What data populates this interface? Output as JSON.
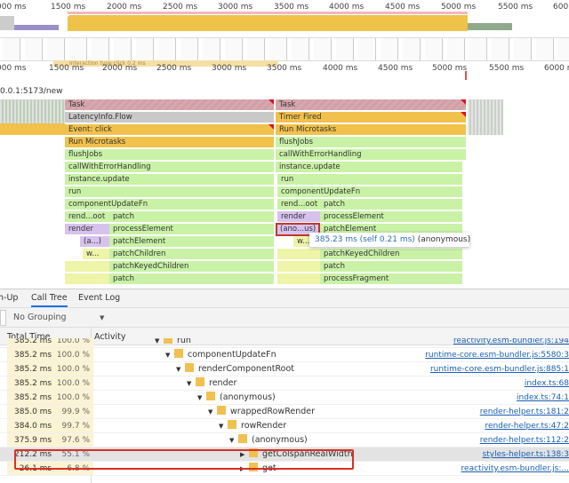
{
  "overview": {
    "ticks": [
      "000 ms",
      "1500 ms",
      "2000 ms",
      "2500 ms",
      "3000 ms",
      "3500 ms",
      "4000 ms",
      "4500 ms",
      "5000 ms",
      "5500 ms",
      "600"
    ]
  },
  "ruler": {
    "ticks": [
      "000 ms",
      "1500 ms",
      "2000 ms",
      "2500 ms",
      "3000 ms",
      "3500 ms",
      "4000 ms",
      "4500 ms",
      "5000 ms",
      "5500 ms",
      "6000 m"
    ],
    "interaction_label": "Interaction type:click 0.2 ms"
  },
  "main": {
    "url": "0.0.1:5173/new"
  },
  "flame_left": [
    "Task",
    "LatencyInfo.Flow",
    "Event: click",
    "Run Microtasks",
    "flushJobs",
    "callWithErrorHandling",
    "instance.update",
    "run",
    "componentUpdateFn",
    "rend...oot",
    "patch",
    "render",
    "processElement",
    "(a...)",
    "patchElement",
    "w...",
    "patchChildren",
    "patchKeyedChildren",
    "patch"
  ],
  "flame_right": [
    "Task",
    "Timer Fired",
    "Run Microtasks",
    "flushJobs",
    "callWithErrorHandling",
    "instance.update",
    "run",
    "componentUpdateFn",
    "rend...oot",
    "patch",
    "render",
    "processElement",
    "(ano...us)",
    "patchElement",
    "w...",
    "patchKeyedChildren",
    "patch",
    "processFragment"
  ],
  "tooltip": {
    "time": "385.23 ms (self 0.21 ms)",
    "name": "(anonymous)"
  },
  "tabs": [
    "n-Up",
    "Call Tree",
    "Event Log"
  ],
  "grouping": "No Grouping",
  "columns": {
    "total": "Total Time",
    "activity": "Activity"
  },
  "rows": [
    {
      "time": "385.2 ms",
      "pct": "100.0 %",
      "name": "run",
      "link": "reactivity.esm-bundler.js:194"
    },
    {
      "time": "385.2 ms",
      "pct": "100.0 %",
      "name": "componentUpdateFn",
      "link": "runtime-core.esm-bundler.js:5580:3"
    },
    {
      "time": "385.2 ms",
      "pct": "100.0 %",
      "name": "renderComponentRoot",
      "link": "runtime-core.esm-bundler.js:885:1"
    },
    {
      "time": "385.2 ms",
      "pct": "100.0 %",
      "name": "render",
      "link": "index.ts:68"
    },
    {
      "time": "385.2 ms",
      "pct": "100.0 %",
      "name": "(anonymous)",
      "link": "index.ts:74:1"
    },
    {
      "time": "385.0 ms",
      "pct": "99.9 %",
      "name": "wrappedRowRender",
      "link": "render-helper.ts:181:2"
    },
    {
      "time": "384.0 ms",
      "pct": "99.7 %",
      "name": "rowRender",
      "link": "render-helper.ts:47:2"
    },
    {
      "time": "375.9 ms",
      "pct": "97.6 %",
      "name": "(anonymous)",
      "link": "render-helper.ts:112:2"
    },
    {
      "time": "212.2 ms",
      "pct": "55.1 %",
      "name": "getColspanRealWidth",
      "link": "styles-helper.ts:138:3"
    },
    {
      "time": "26.1 ms",
      "pct": "6.8 %",
      "name": "get",
      "link": "reactivity.esm-bundler.js:..."
    }
  ],
  "colors": {
    "highlight": "#d93025",
    "link": "#1a5fb4"
  }
}
